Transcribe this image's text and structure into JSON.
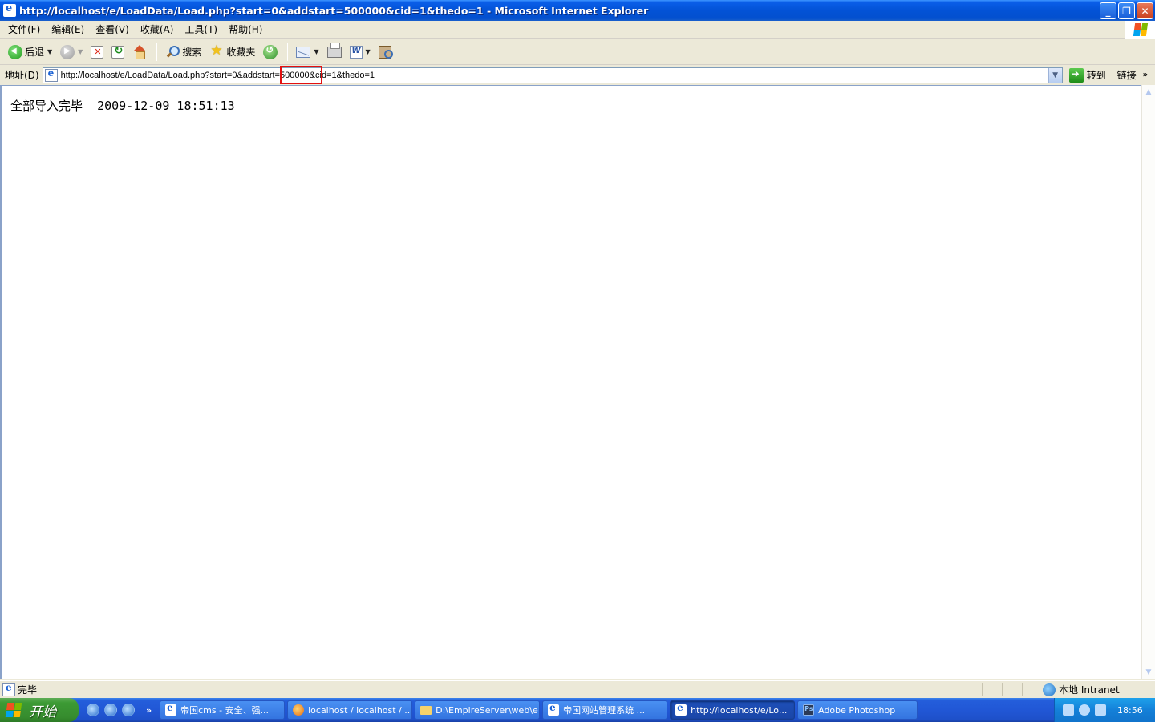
{
  "window": {
    "title": "http://localhost/e/LoadData/Load.php?start=0&addstart=500000&cid=1&thedo=1 - Microsoft Internet Explorer",
    "minimize": "_",
    "restore": "❐",
    "close": "✕"
  },
  "menu": {
    "items": [
      "文件(F)",
      "编辑(E)",
      "查看(V)",
      "收藏(A)",
      "工具(T)",
      "帮助(H)"
    ]
  },
  "toolbar": {
    "back_label": "后退",
    "search_label": "搜索",
    "favorites_label": "收藏夹"
  },
  "address": {
    "label": "地址(D)",
    "url": "http://localhost/e/LoadData/Load.php?start=0&addstart=500000&cid=1&thedo=1",
    "go_label": "转到",
    "links_label": "链接"
  },
  "page": {
    "message": "全部导入完毕",
    "timestamp": "2009-12-09 18:51:13"
  },
  "status": {
    "text": "完毕",
    "zone": "本地 Intranet"
  },
  "taskbar": {
    "start_label": "开始",
    "tasks": [
      {
        "label": "帝国cms - 安全、强...",
        "icon": "ie-icon"
      },
      {
        "label": "localhost / localhost / ...",
        "icon": "firefox-icon"
      },
      {
        "label": "D:\\EmpireServer\\web\\e",
        "icon": "folder-icon"
      },
      {
        "label": "帝国网站管理系统 ...",
        "icon": "ie-icon"
      },
      {
        "label": "http://localhost/e/Lo...",
        "icon": "ie-icon"
      },
      {
        "label": "Adobe Photoshop",
        "icon": "photoshop-icon"
      }
    ],
    "clock": "18:56"
  },
  "colors": {
    "highlight_box": "#e31010",
    "titlebar": "#0352d6",
    "taskbar": "#2157d6",
    "start_button": "#368c2e"
  }
}
